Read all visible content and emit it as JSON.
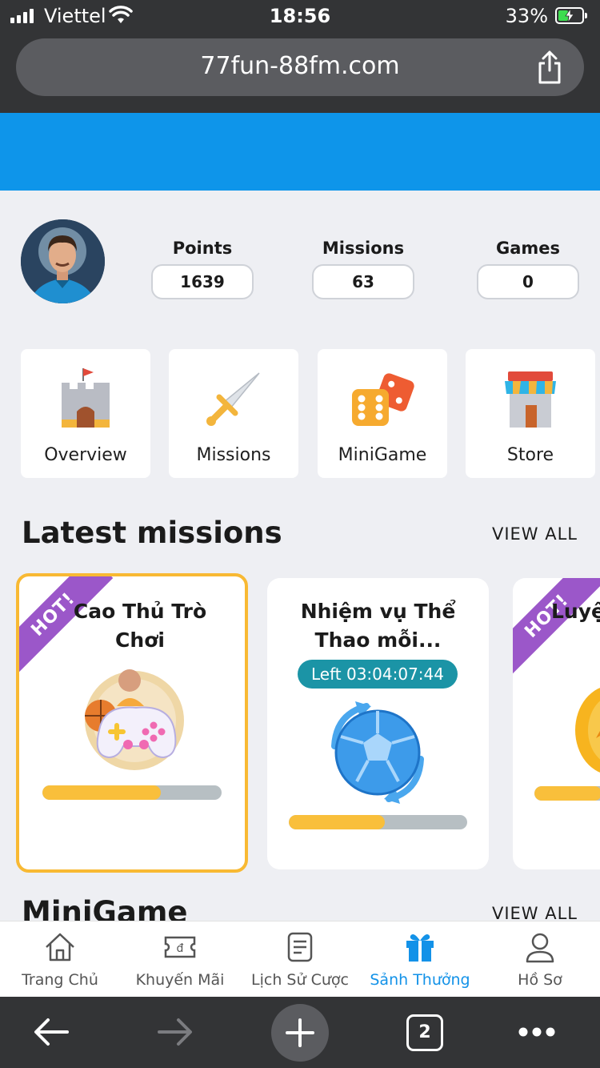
{
  "status": {
    "carrier": "Viettel",
    "time": "18:56",
    "battery": "33%",
    "battery_level": 0.33
  },
  "browser": {
    "url": "77fun-88fm.com",
    "tab_count": "2"
  },
  "profile": {
    "stats": [
      {
        "label": "Points",
        "value": "1639"
      },
      {
        "label": "Missions",
        "value": "63"
      },
      {
        "label": "Games",
        "value": "0"
      }
    ]
  },
  "menu": [
    {
      "label": "Overview",
      "icon": "castle-icon"
    },
    {
      "label": "Missions",
      "icon": "sword-icon"
    },
    {
      "label": "MiniGame",
      "icon": "dice-icon"
    },
    {
      "label": "Store",
      "icon": "store-icon"
    }
  ],
  "latest": {
    "title": "Latest missions",
    "view_all": "VIEW ALL",
    "cards": [
      {
        "title": "Cao Thủ Trò Chơi",
        "badge": "HOT!",
        "progress": 0.66
      },
      {
        "title": "Nhiệm vụ Thể Thao mỗi...",
        "timer": "Left 03:04:07:44",
        "progress": 0.54
      },
      {
        "title": "Luyệ",
        "badge": "HOT!",
        "progress": 0.6
      }
    ]
  },
  "minigame": {
    "title": "MiniGame",
    "view_all": "VIEW ALL"
  },
  "nav": [
    {
      "label": "Trang Chủ",
      "icon": "home-icon"
    },
    {
      "label": "Khuyến Mãi",
      "icon": "ticket-icon"
    },
    {
      "label": "Lịch Sử Cược",
      "icon": "history-icon"
    },
    {
      "label": "Sảnh Thưởng",
      "icon": "gift-icon",
      "active": true
    },
    {
      "label": "Hồ Sơ",
      "icon": "profile-icon"
    }
  ],
  "colors": {
    "accent": "#1392e8",
    "header_blue": "#0e95ea",
    "progress": "#f9bf3b",
    "ribbon": "#9b57c9",
    "timer": "#1b94a6"
  }
}
